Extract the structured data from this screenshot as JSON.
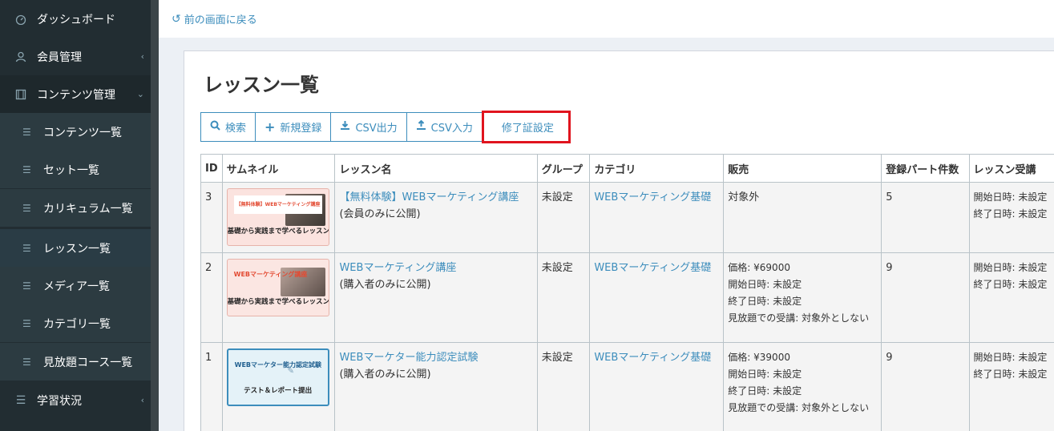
{
  "topbar": {
    "back_label": "前の画面に戻る"
  },
  "sidebar": {
    "items": [
      {
        "label": "ダッシュボード"
      },
      {
        "label": "会員管理"
      },
      {
        "label": "コンテンツ管理"
      },
      {
        "label": "コンテンツ一覧"
      },
      {
        "label": "セット一覧"
      },
      {
        "label": "カリキュラム一覧"
      },
      {
        "label": "レッスン一覧"
      },
      {
        "label": "メディア一覧"
      },
      {
        "label": "カテゴリ一覧"
      },
      {
        "label": "見放題コース一覧"
      },
      {
        "label": "学習状況"
      }
    ]
  },
  "main": {
    "title": "レッスン一覧",
    "buttons": {
      "search": "検索",
      "new": "新規登録",
      "csv_out": "CSV出力",
      "csv_in": "CSV入力",
      "certificate": "修了証設定"
    },
    "table": {
      "headers": [
        "ID",
        "サムネイル",
        "レッスン名",
        "グループ",
        "カテゴリ",
        "販売",
        "登録パート件数",
        "レッスン受講"
      ],
      "rows": [
        {
          "id": "3",
          "thumb_top": "【無料体験】WEBマーケティング講座",
          "thumb_bottom": "基礎から実践まで学べるレッスン",
          "name": "【無料体験】WEBマーケティング講座",
          "visibility": "(会員のみに公開)",
          "group": "未設定",
          "category": "WEBマーケティング基礎",
          "sales": [
            "対象外"
          ],
          "parts": "5",
          "period": [
            "開始日時: 未設定",
            "終了日時: 未設定"
          ]
        },
        {
          "id": "2",
          "thumb_top": "WEBマーケティング講座",
          "thumb_bottom": "基礎から実践まで学べるレッスン",
          "name": "WEBマーケティング講座",
          "visibility": "(購入者のみに公開)",
          "group": "未設定",
          "category": "WEBマーケティング基礎",
          "sales": [
            "価格: ¥69000",
            "開始日時: 未設定",
            "終了日時: 未設定",
            "見放題での受講: 対象外としない"
          ],
          "parts": "9",
          "period": [
            "開始日時: 未設定",
            "終了日時: 未設定"
          ]
        },
        {
          "id": "1",
          "thumb_top": "WEBマーケター能力認定試験",
          "thumb_bottom": "テスト＆レポート提出",
          "name": "WEBマーケター能力認定試験",
          "visibility": "(購入者のみに公開)",
          "group": "未設定",
          "category": "WEBマーケティング基礎",
          "sales": [
            "価格: ¥39000",
            "開始日時: 未設定",
            "終了日時: 未設定",
            "見放題での受講: 対象外としない"
          ],
          "parts": "9",
          "period": [
            "開始日時: 未設定",
            "終了日時: 未設定"
          ]
        }
      ]
    }
  }
}
